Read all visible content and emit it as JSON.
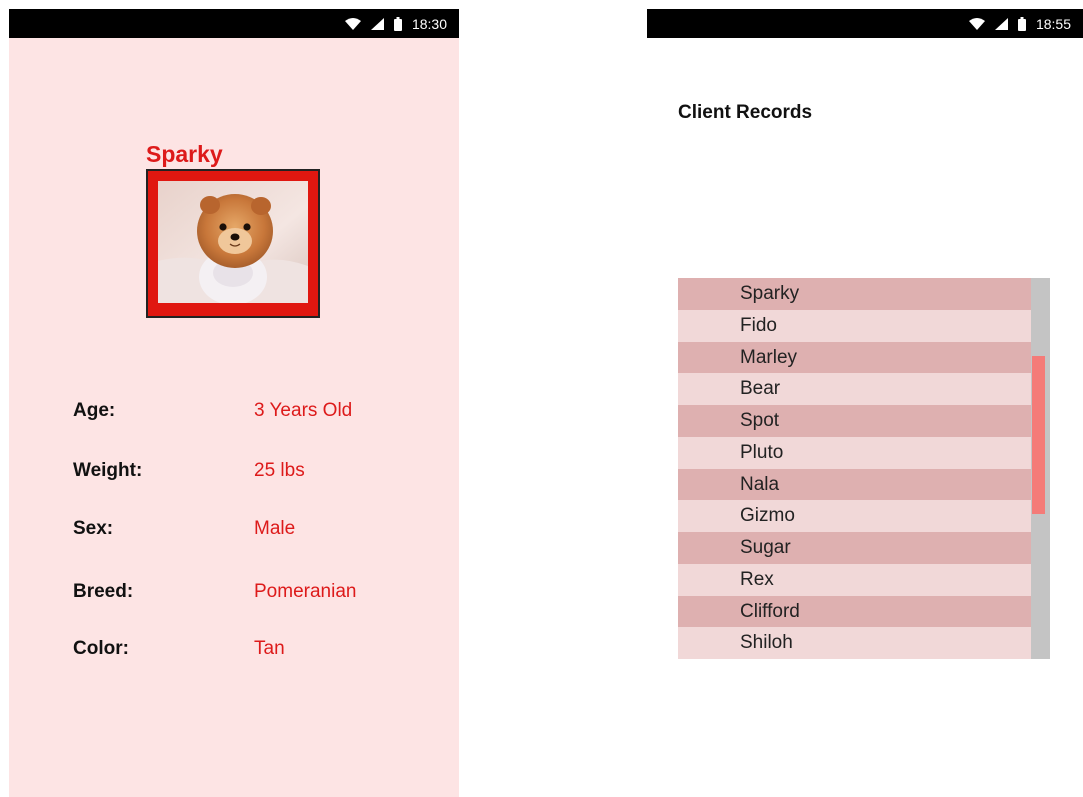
{
  "profile_screen": {
    "status_time": "18:30",
    "pet_name": "Sparky",
    "photo_alt": "Sparky photo",
    "details": [
      {
        "label": "Age:",
        "value": "3 Years Old"
      },
      {
        "label": "Weight:",
        "value": "25 lbs"
      },
      {
        "label": "Sex:",
        "value": "Male"
      },
      {
        "label": "Breed:",
        "value": "Pomeranian"
      },
      {
        "label": "Color:",
        "value": "Tan"
      }
    ]
  },
  "records_screen": {
    "status_time": "18:55",
    "title": "Client Records",
    "clients": [
      "Sparky",
      "Fido",
      "Marley",
      "Bear",
      "Spot",
      "Pluto",
      "Nala",
      "Gizmo",
      "Sugar",
      "Rex",
      "Clifford",
      "Shiloh"
    ],
    "scroll_position": 0.33
  },
  "colors": {
    "accent_red": "#dd1a1a",
    "profile_background": "#fde4e4",
    "row_dark": "#deb0b0",
    "row_light": "#f1d8d8",
    "scroll_thumb": "#f47b78"
  },
  "icons": [
    "wifi-icon",
    "signal-icon",
    "battery-icon",
    "scroll-up-arrow-icon",
    "scroll-down-arrow-icon"
  ]
}
